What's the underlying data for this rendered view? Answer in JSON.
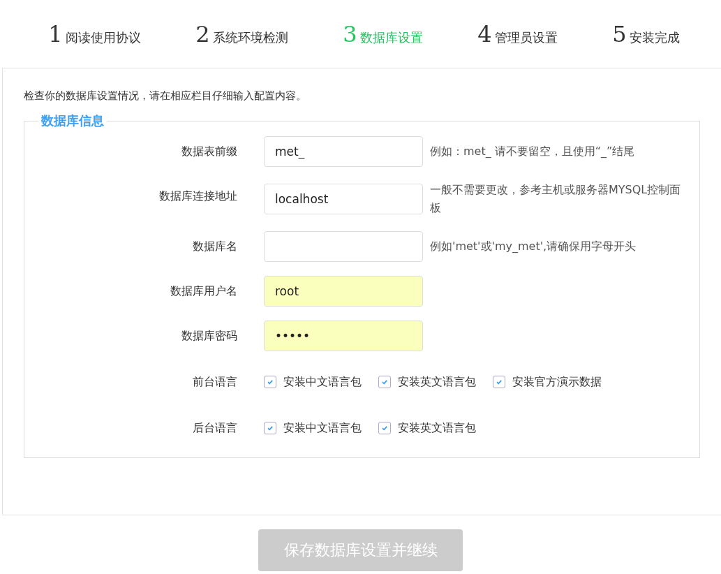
{
  "steps": [
    {
      "number": "1",
      "label": "阅读使用协议",
      "selected": false
    },
    {
      "number": "2",
      "label": "系统环境检测",
      "selected": false
    },
    {
      "number": "3",
      "label": "数据库设置",
      "selected": true
    },
    {
      "number": "4",
      "label": "管理员设置",
      "selected": false
    },
    {
      "number": "5",
      "label": "安装完成",
      "selected": false
    }
  ],
  "intro": "检查你的数据库设置情况，请在相应栏目仔细输入配置内容。",
  "fieldset": {
    "legend": "数据库信息",
    "fields": [
      {
        "kind": "input",
        "label": "数据表前缀",
        "value": "met_",
        "autofilled": false,
        "hint": "例如：met_ 请不要留空，且使用“_”结尾"
      },
      {
        "kind": "input",
        "label": "数据库连接地址",
        "value": "localhost",
        "autofilled": false,
        "hint": "一般不需要更改，参考主机或服务器MYSQL控制面板"
      },
      {
        "kind": "input",
        "label": "数据库名",
        "autofilled": false,
        "hint": "例如'met'或'my_met',请确保用字母开头"
      },
      {
        "kind": "input",
        "label": "数据库用户名",
        "value": "root",
        "autofilled": true
      },
      {
        "kind": "input",
        "label": "数据库密码",
        "value": "•••••",
        "autofilled": true
      },
      {
        "kind": "checkboxes",
        "label": "前台语言",
        "options": [
          {
            "label": "安装中文语言包",
            "checked": true
          },
          {
            "label": "安装英文语言包",
            "checked": true
          },
          {
            "label": "安装官方演示数据",
            "checked": true
          }
        ]
      },
      {
        "kind": "checkboxes",
        "label": "后台语言",
        "options": [
          {
            "label": "安装中文语言包",
            "checked": true
          },
          {
            "label": "安装英文语言包",
            "checked": true
          }
        ]
      }
    ]
  },
  "submit": {
    "label": "保存数据库设置并继续",
    "disabled": true
  }
}
